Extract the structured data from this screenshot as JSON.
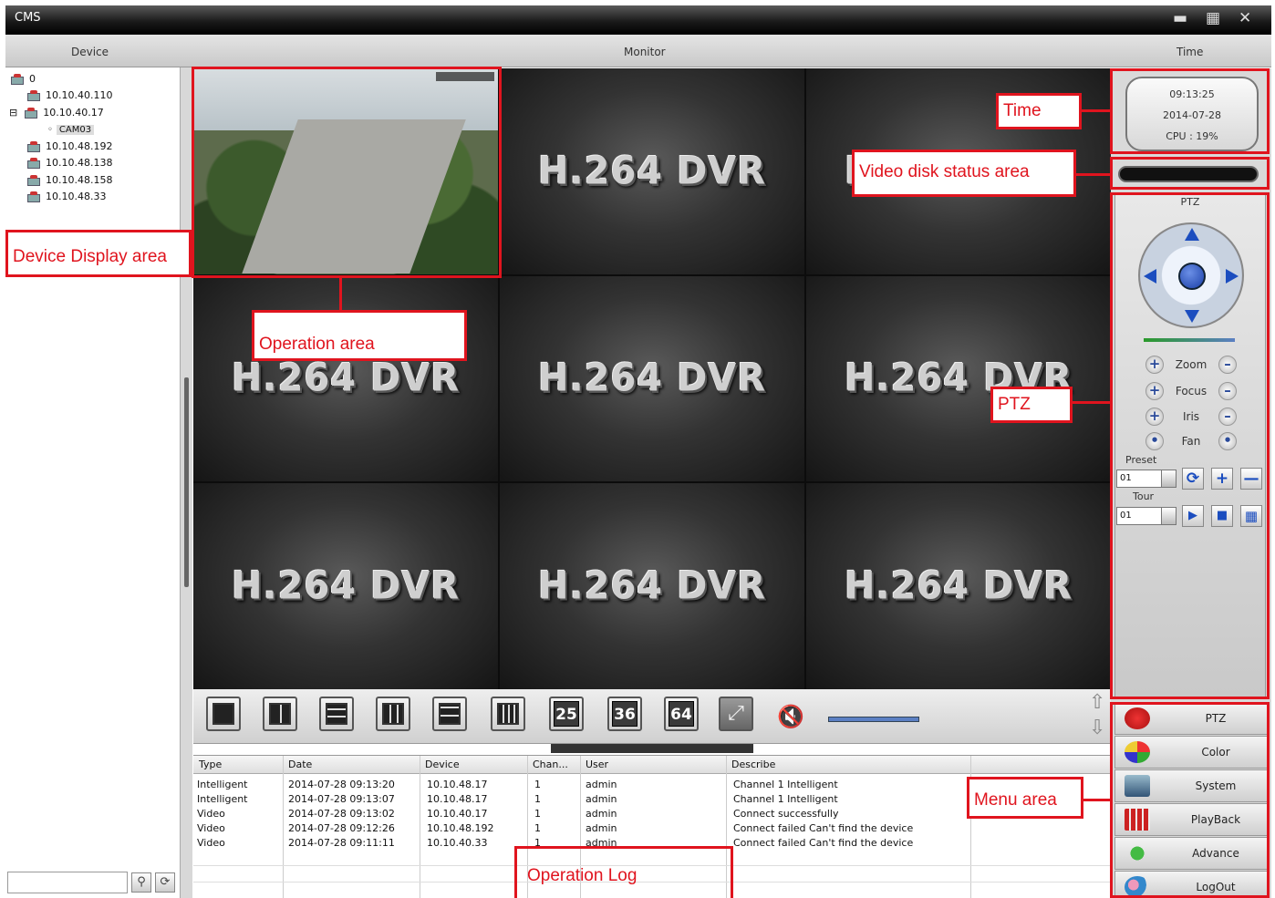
{
  "window": {
    "title": "CMS"
  },
  "columns": {
    "device": "Device",
    "monitor": "Monitor",
    "time": "Time"
  },
  "device_tree": {
    "root": "0",
    "items": [
      "10.10.40.110",
      "10.10.40.17",
      "CAM03",
      "10.10.48.192",
      "10.10.48.138",
      "10.10.48.158",
      "10.10.48.33"
    ]
  },
  "video": {
    "placeholder": "H.264 DVR",
    "cells": 9,
    "active_cell": 1
  },
  "toolbar": {
    "layouts": [
      "1",
      "4",
      "6",
      "8",
      "9",
      "16",
      "25",
      "36",
      "64"
    ]
  },
  "log": {
    "headers": [
      "Type",
      "Date",
      "Device",
      "Chan...",
      "User",
      "Describe"
    ],
    "rows": [
      [
        "Intelligent",
        "2014-07-28 09:13:20",
        "10.10.48.17",
        "1",
        "admin",
        "Channel 1 Intelligent"
      ],
      [
        "Intelligent",
        "2014-07-28 09:13:07",
        "10.10.48.17",
        "1",
        "admin",
        "Channel 1 Intelligent"
      ],
      [
        "Video",
        "2014-07-28 09:13:02",
        "10.10.40.17",
        "1",
        "admin",
        "Connect successfully"
      ],
      [
        "Video",
        "2014-07-28 09:12:26",
        "10.10.48.192",
        "1",
        "admin",
        "Connect failed Can't find the device"
      ],
      [
        "Video",
        "2014-07-28 09:11:11",
        "10.10.40.33",
        "1",
        "admin",
        "Connect failed Can't find the device"
      ]
    ]
  },
  "clock": {
    "time": "09:13:25",
    "date": "2014-07-28",
    "cpu": "CPU : 19%"
  },
  "ptz": {
    "title": "PTZ",
    "controls": [
      "Zoom",
      "Focus",
      "Iris",
      "Fan"
    ],
    "preset_label": "Preset",
    "preset_value": "01",
    "tour_label": "Tour",
    "tour_value": "01"
  },
  "menu": {
    "items": [
      "PTZ",
      "Color",
      "System",
      "PlayBack",
      "Advance",
      "LogOut"
    ]
  },
  "annotations": {
    "time": "Time",
    "disk": "Video disk status area",
    "device": "Device Display area",
    "operation": "Operation area",
    "ptz": "PTZ",
    "menu": "Menu area",
    "log": "Operation Log"
  },
  "colors": {
    "annotation": "#e0141e",
    "accent": "#1b4dbf"
  }
}
